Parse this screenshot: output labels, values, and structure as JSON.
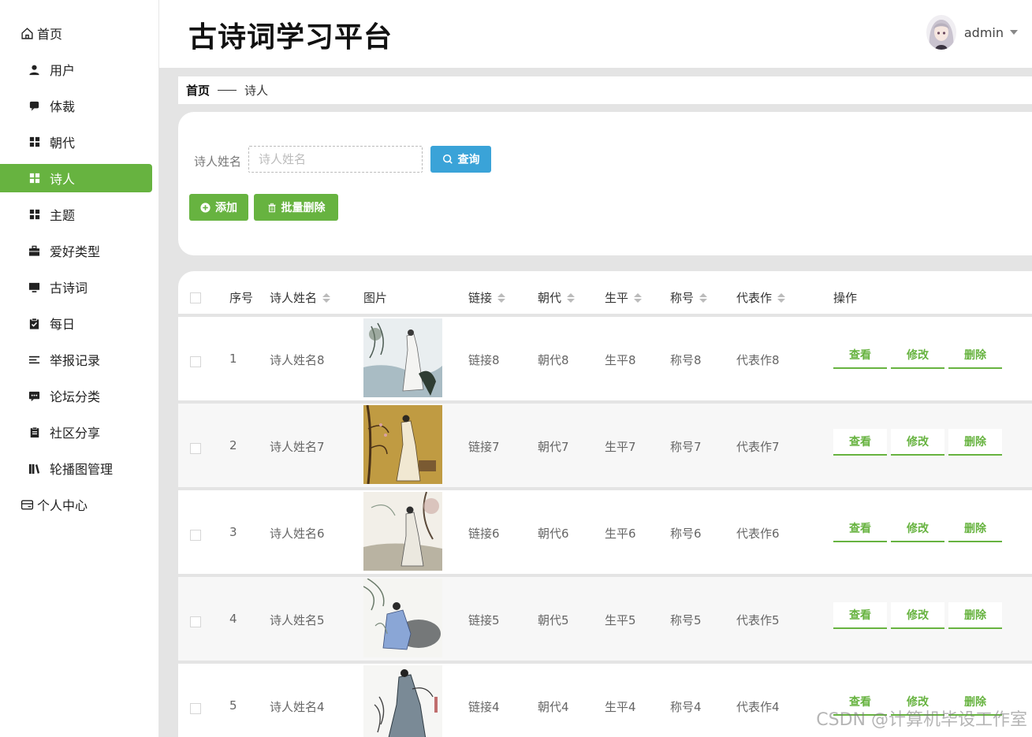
{
  "header": {
    "title": "古诗词学习平台",
    "username": "admin"
  },
  "sidebar": {
    "items": [
      {
        "label": "首页",
        "icon": "home-icon",
        "level": "top"
      },
      {
        "label": "用户",
        "icon": "user-icon",
        "level": "sub"
      },
      {
        "label": "体裁",
        "icon": "chat-icon",
        "level": "sub"
      },
      {
        "label": "朝代",
        "icon": "grid-icon",
        "level": "sub"
      },
      {
        "label": "诗人",
        "icon": "grid-icon",
        "level": "sub",
        "active": true
      },
      {
        "label": "主题",
        "icon": "grid-icon",
        "level": "sub"
      },
      {
        "label": "爱好类型",
        "icon": "briefcase-icon",
        "level": "sub"
      },
      {
        "label": "古诗词",
        "icon": "monitor-icon",
        "level": "sub"
      },
      {
        "label": "每日",
        "icon": "clipboard-check-icon",
        "level": "sub"
      },
      {
        "label": "举报记录",
        "icon": "list-icon",
        "level": "sub"
      },
      {
        "label": "论坛分类",
        "icon": "message-icon",
        "level": "sub"
      },
      {
        "label": "社区分享",
        "icon": "document-icon",
        "level": "sub"
      },
      {
        "label": "轮播图管理",
        "icon": "books-icon",
        "level": "sub"
      },
      {
        "label": "个人中心",
        "icon": "card-icon",
        "level": "top"
      }
    ]
  },
  "breadcrumb": {
    "home": "首页",
    "current": "诗人"
  },
  "search": {
    "label": "诗人姓名",
    "placeholder": "诗人姓名",
    "value": "",
    "query_label": "查询"
  },
  "actions": {
    "add_label": "添加",
    "batch_delete_label": "批量删除"
  },
  "table": {
    "columns": [
      "序号",
      "诗人姓名",
      "图片",
      "链接",
      "朝代",
      "生平",
      "称号",
      "代表作",
      "操作"
    ],
    "rows": [
      {
        "index": "1",
        "name": "诗人姓名8",
        "link": "链接8",
        "dynasty": "朝代8",
        "bio": "生平8",
        "title": "称号8",
        "work": "代表作8"
      },
      {
        "index": "2",
        "name": "诗人姓名7",
        "link": "链接7",
        "dynasty": "朝代7",
        "bio": "生平7",
        "title": "称号7",
        "work": "代表作7"
      },
      {
        "index": "3",
        "name": "诗人姓名6",
        "link": "链接6",
        "dynasty": "朝代6",
        "bio": "生平6",
        "title": "称号6",
        "work": "代表作6"
      },
      {
        "index": "4",
        "name": "诗人姓名5",
        "link": "链接5",
        "dynasty": "朝代5",
        "bio": "生平5",
        "title": "称号5",
        "work": "代表作5"
      },
      {
        "index": "5",
        "name": "诗人姓名4",
        "link": "链接4",
        "dynasty": "朝代4",
        "bio": "生平4",
        "title": "称号4",
        "work": "代表作4"
      }
    ],
    "ops": {
      "view": "查看",
      "edit": "修改",
      "delete": "删除"
    }
  },
  "watermark": "CSDN @计算机毕设工作室",
  "colors": {
    "primary": "#67b340",
    "query": "#3aa3d8",
    "background": "#e4e4e4"
  }
}
